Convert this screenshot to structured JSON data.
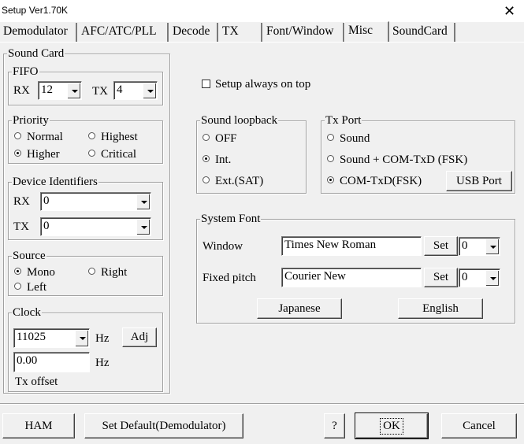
{
  "window": {
    "title": "Setup Ver1.70K",
    "close_glyph": "✕"
  },
  "tabs": [
    {
      "label": "Demodulator"
    },
    {
      "label": "AFC/ATC/PLL"
    },
    {
      "label": "Decode"
    },
    {
      "label": "TX"
    },
    {
      "label": "Font/Window"
    },
    {
      "label": "Misc"
    },
    {
      "label": "SoundCard"
    }
  ],
  "sound_card": {
    "title": "Sound Card",
    "fifo": {
      "title": "FIFO",
      "rx_label": "RX",
      "rx_value": "12",
      "tx_label": "TX",
      "tx_value": "4"
    },
    "priority": {
      "title": "Priority",
      "normal": "Normal",
      "highest": "Highest",
      "higher": "Higher",
      "critical": "Critical",
      "selected": "Higher"
    },
    "device": {
      "title": "Device Identifiers",
      "rx_label": "RX",
      "rx_value": "0",
      "tx_label": "TX",
      "tx_value": "0"
    },
    "source": {
      "title": "Source",
      "mono": "Mono",
      "right": "Right",
      "left": "Left",
      "selected": "Mono"
    },
    "clock": {
      "title": "Clock",
      "rate": "11025",
      "hz1": "Hz",
      "adj": "Adj",
      "offset": "0.00",
      "hz2": "Hz",
      "tx_offset": "Tx offset"
    }
  },
  "misc": {
    "always_on_top": "Setup always on top",
    "loopback": {
      "title": "Sound loopback",
      "off": "OFF",
      "int": "Int.",
      "ext": "Ext.(SAT)",
      "selected": "Int."
    },
    "tx_port": {
      "title": "Tx Port",
      "sound": "Sound",
      "sound_com": "Sound + COM-TxD (FSK)",
      "com": "COM-TxD(FSK)",
      "usb": "USB Port",
      "selected": "COM-TxD(FSK)"
    },
    "system_font": {
      "title": "System Font",
      "window_label": "Window",
      "window_font": "Times New Roman",
      "window_set": "Set",
      "window_size": "0",
      "fixed_label": "Fixed pitch",
      "fixed_font": "Courier New",
      "fixed_set": "Set",
      "fixed_size": "0",
      "japanese": "Japanese",
      "english": "English"
    }
  },
  "footer": {
    "ham": "HAM",
    "set_default": "Set Default(Demodulator)",
    "help": "?",
    "ok": "OK",
    "cancel": "Cancel"
  }
}
